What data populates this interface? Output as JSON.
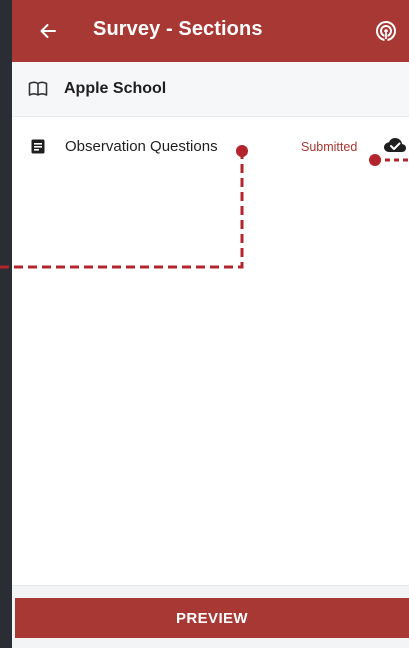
{
  "app_bar": {
    "title": "Survey - Sections",
    "back_icon": "arrow-left-icon",
    "sync_icon": "broadcast-sync-icon",
    "background": "#a83834"
  },
  "school": {
    "name": "Apple School",
    "icon": "book-open-icon"
  },
  "sections": [
    {
      "name": "Observation Questions",
      "status": "Submitted",
      "icon": "document-icon",
      "status_icon": "cloud-check-icon"
    }
  ],
  "footer": {
    "preview_label": "PREVIEW"
  },
  "colors": {
    "accent": "#a83834",
    "callout": "#b3252c",
    "row_bg": "#f5f7f9"
  }
}
